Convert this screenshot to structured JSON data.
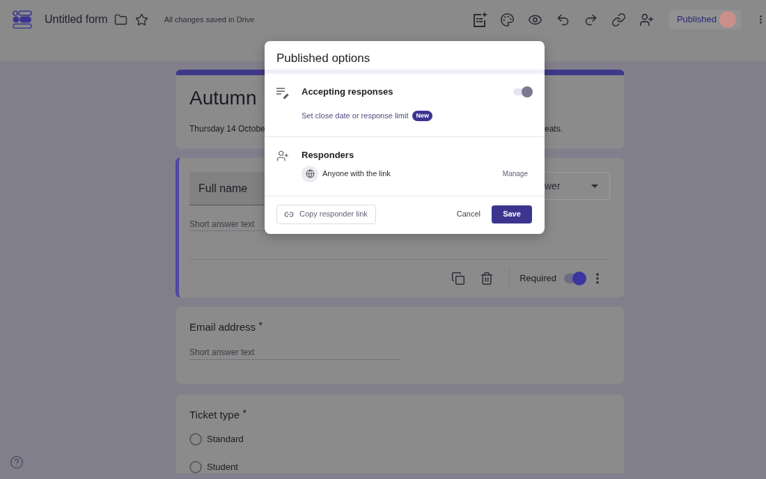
{
  "header": {
    "title": "Untitled form",
    "save_status": "All changes saved in Drive",
    "publish_button": "Published"
  },
  "form": {
    "title": "Autumn",
    "description_left": "Thursday 14 Octobe",
    "description_right": "eats."
  },
  "questions": [
    {
      "kind": "editing",
      "title": "Full name",
      "question_type": "wer",
      "placeholder": "Short answer text",
      "required_label": "Required",
      "required": true
    },
    {
      "kind": "short_answer",
      "title": "Email address",
      "required_mark": "*",
      "placeholder": "Short answer text"
    },
    {
      "kind": "choice",
      "title": "Ticket type",
      "required_mark": "*",
      "options": [
        {
          "label": "Standard",
          "selected": false
        },
        {
          "label": "Student",
          "selected": false
        }
      ]
    }
  ],
  "dialog": {
    "title": "Published options",
    "sections": [
      {
        "kind": "toggle",
        "heading": "Accepting responses",
        "on": true,
        "link": "Set close date or response limit",
        "badge": "New"
      },
      {
        "kind": "access",
        "heading": "Responders",
        "audience": "Anyone with the link",
        "action": "Manage"
      }
    ],
    "copy_button": "Copy responder link",
    "cancel_button": "Cancel",
    "save_button": "Save"
  }
}
